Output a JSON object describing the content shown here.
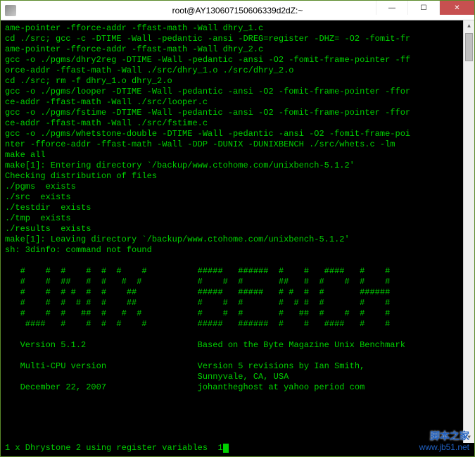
{
  "titlebar": {
    "title": "root@AY130607150606339d2dZ:~",
    "min": "—",
    "max": "☐",
    "close": "✕"
  },
  "terminal": {
    "lines": [
      "ame-pointer -fforce-addr -ffast-math -Wall dhry_1.c",
      "cd ./src; gcc -c -DTIME -Wall -pedantic -ansi -DREG=register -DHZ= -O2 -fomit-fr",
      "ame-pointer -fforce-addr -ffast-math -Wall dhry_2.c",
      "gcc -o ./pgms/dhry2reg -DTIME -Wall -pedantic -ansi -O2 -fomit-frame-pointer -ff",
      "orce-addr -ffast-math -Wall ./src/dhry_1.o ./src/dhry_2.o",
      "cd ./src; rm -f dhry_1.o dhry_2.o",
      "gcc -o ./pgms/looper -DTIME -Wall -pedantic -ansi -O2 -fomit-frame-pointer -ffor",
      "ce-addr -ffast-math -Wall ./src/looper.c",
      "gcc -o ./pgms/fstime -DTIME -Wall -pedantic -ansi -O2 -fomit-frame-pointer -ffor",
      "ce-addr -ffast-math -Wall ./src/fstime.c",
      "gcc -o ./pgms/whetstone-double -DTIME -Wall -pedantic -ansi -O2 -fomit-frame-poi",
      "nter -fforce-addr -ffast-math -Wall -DDP -DUNIX -DUNIXBENCH ./src/whets.c -lm",
      "make all",
      "make[1]: Entering directory `/backup/www.ctohome.com/unixbench-5.1.2'",
      "Checking distribution of files",
      "./pgms  exists",
      "./src  exists",
      "./testdir  exists",
      "./tmp  exists",
      "./results  exists",
      "make[1]: Leaving directory `/backup/www.ctohome.com/unixbench-5.1.2'",
      "sh: 3dinfo: command not found",
      "",
      "   #    #  #    #  #  #    #          #####   ######  #    #   ####   #    #",
      "   #    #  ##   #  #   #  #           #    #  #       ##   #  #    #  #    #",
      "   #    #  # #  #  #    ##            #####   #####   # #  #  #       ######",
      "   #    #  #  # #  #    ##            #    #  #       #  # #  #       #    #",
      "   #    #  #   ##  #   #  #           #    #  #       #   ##  #    #  #    #",
      "    ####   #    #  #  #    #          #####   ######  #    #   ####   #    #",
      "",
      "   Version 5.1.2                      Based on the Byte Magazine Unix Benchmark",
      "",
      "   Multi-CPU version                  Version 5 revisions by Ian Smith,",
      "                                      Sunnyvale, CA, USA",
      "   December 22, 2007                  johantheghost at yahoo period com",
      "",
      ""
    ],
    "status": "1 x Dhrystone 2 using register variables  1"
  },
  "watermark": {
    "cn": "脚本之家",
    "url": "www.jb51.net"
  }
}
